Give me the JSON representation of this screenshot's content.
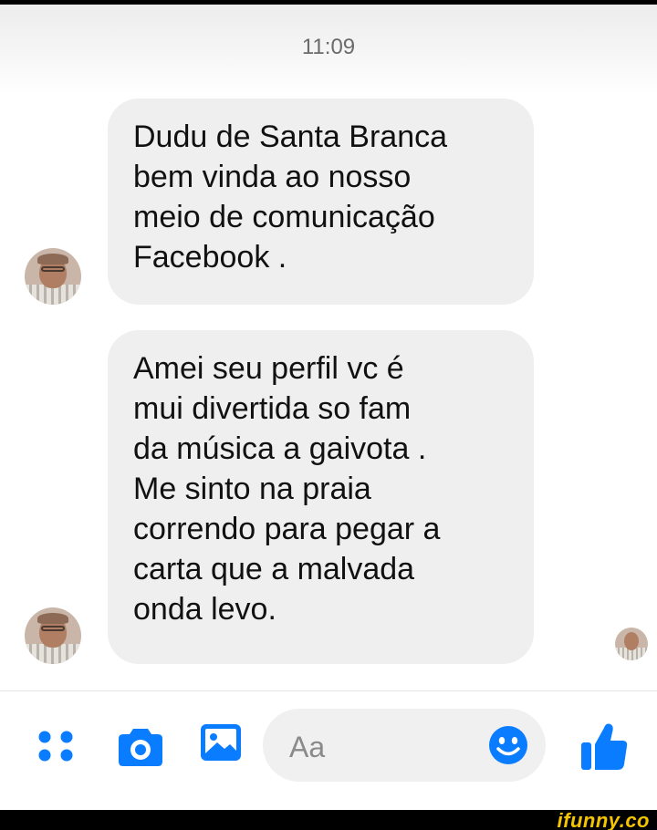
{
  "status": {
    "time": "11:09"
  },
  "messages": [
    {
      "lines": [
        "Dudu de Santa Branca",
        "bem vinda ao nosso",
        "meio de comunicação",
        "Facebook ."
      ]
    },
    {
      "lines": [
        "Amei seu perfil vc é",
        "mui divertida so fam",
        "da música a gaivota .",
        "Me sinto na praia",
        "correndo para pegar a",
        "carta que a malvada",
        "onda levo."
      ]
    }
  ],
  "composer": {
    "placeholder": "Aa"
  },
  "icons": {
    "more": "four-dots-icon",
    "camera": "camera-icon",
    "gallery": "image-gallery-icon",
    "emoji": "smiley-icon",
    "like": "thumbs-up-icon"
  },
  "colors": {
    "accent": "#0a7cff",
    "bubble": "#efefef",
    "watermark": "#f5c400"
  },
  "watermark": {
    "text": "ifunny.co"
  }
}
